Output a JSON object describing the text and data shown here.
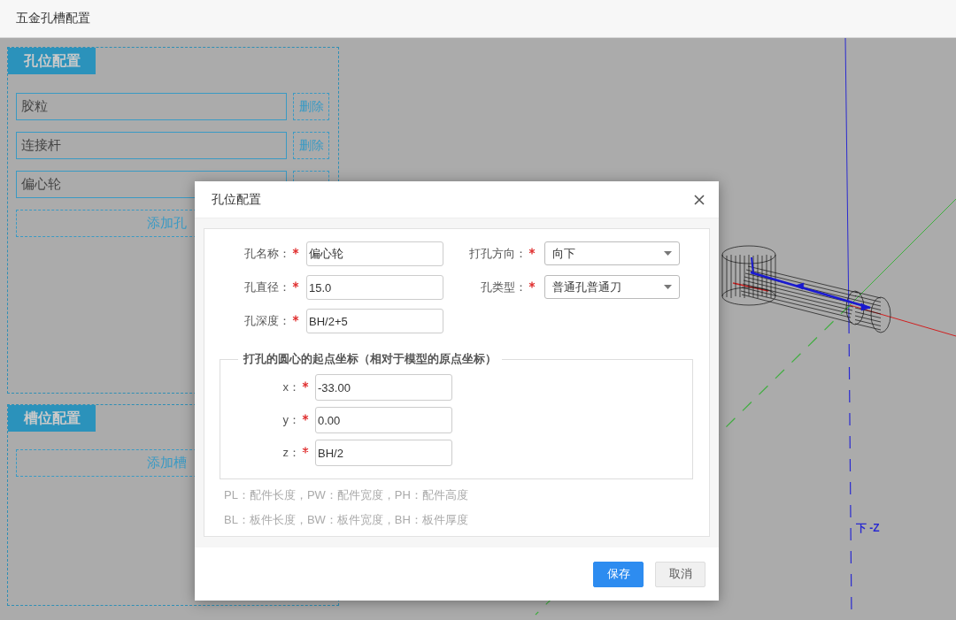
{
  "header": {
    "title": "五金孔槽配置"
  },
  "hole_section": {
    "tab": "孔位配置",
    "items": [
      {
        "name": "胶粒",
        "action": "删除"
      },
      {
        "name": "连接杆",
        "action": "删除"
      },
      {
        "name": "偏心轮"
      }
    ],
    "add_button": "添加孔"
  },
  "slot_section": {
    "tab": "槽位配置",
    "add_button": "添加槽"
  },
  "viewport": {
    "axis_label": "下 -Z"
  },
  "dialog": {
    "title": "孔位配置",
    "fields": [
      {
        "label": "孔名称：",
        "required": true,
        "kind": "text",
        "value": "偏心轮"
      },
      {
        "label": "打孔方向：",
        "required": true,
        "kind": "select",
        "value": "向下"
      },
      {
        "label": "孔直径：",
        "required": true,
        "kind": "text",
        "value": "15.0"
      },
      {
        "label": "孔类型：",
        "required": true,
        "kind": "select",
        "value": "普通孔普通刀"
      },
      {
        "label": "孔深度：",
        "required": true,
        "kind": "text",
        "value": "BH/2+5"
      }
    ],
    "coordinates": {
      "legend": "打孔的圆心的起点坐标（相对于模型的原点坐标）",
      "fields": [
        {
          "label": "x：",
          "required": true,
          "value": "-33.00"
        },
        {
          "label": "y：",
          "required": true,
          "value": "0.00"
        },
        {
          "label": "z：",
          "required": true,
          "value": "BH/2"
        }
      ]
    },
    "notes": [
      "PL：配件长度，PW：配件宽度，PH：配件高度",
      "BL：板件长度，BW：板件宽度，BH：板件厚度"
    ],
    "buttons": [
      {
        "label": "保存",
        "kind": "primary"
      },
      {
        "label": "取消",
        "kind": "default"
      }
    ]
  }
}
